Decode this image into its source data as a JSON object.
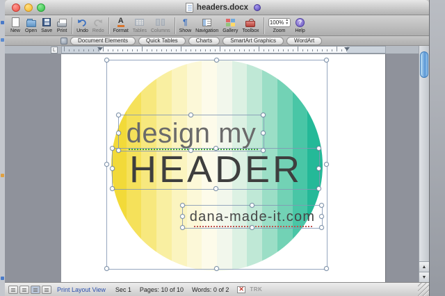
{
  "title_bar": {
    "title": "headers.docx"
  },
  "toolbar": {
    "buttons": [
      {
        "label": "New"
      },
      {
        "label": "Open"
      },
      {
        "label": "Save"
      },
      {
        "label": "Print"
      },
      {
        "label": "Undo"
      },
      {
        "label": "Redo",
        "disabled": true
      },
      {
        "label": "Format"
      },
      {
        "label": "Tables",
        "disabled": true
      },
      {
        "label": "Columns",
        "disabled": true
      },
      {
        "label": "Show"
      },
      {
        "label": "Navigation"
      },
      {
        "label": "Gallery"
      },
      {
        "label": "Toolbox"
      },
      {
        "label": "Zoom",
        "value": "100%"
      },
      {
        "label": "Help"
      }
    ]
  },
  "elements_gallery": {
    "tabs": [
      {
        "label": "Document Elements"
      },
      {
        "label": "Quick Tables"
      },
      {
        "label": "Charts"
      },
      {
        "label": "SmartArt Graphics"
      },
      {
        "label": "WordArt"
      }
    ]
  },
  "document": {
    "logo": {
      "line1": "design my",
      "line2": "HEADER",
      "line3": "dana-made-it.com",
      "line1_color": "#6a6a6a",
      "line2_color": "#3e3e3e",
      "line3_color": "#464646",
      "stripe_colors": [
        "#f2da39",
        "#f5e15a",
        "#f7e87e",
        "#f9efa1",
        "#fbf4bf",
        "#fcf8d8",
        "#fdfbea",
        "#f2f7ec",
        "#dcf1e3",
        "#bfe8d6",
        "#9bdec6",
        "#72d2b5",
        "#49c6a6",
        "#24b998"
      ]
    }
  },
  "status_bar": {
    "view_mode": "Print Layout View",
    "section": "Sec 1",
    "pages_label": "Pages:",
    "pages_value": "10 of 10",
    "words_label": "Words:",
    "words_value": "0 of 2",
    "track_changes": "TRK"
  }
}
